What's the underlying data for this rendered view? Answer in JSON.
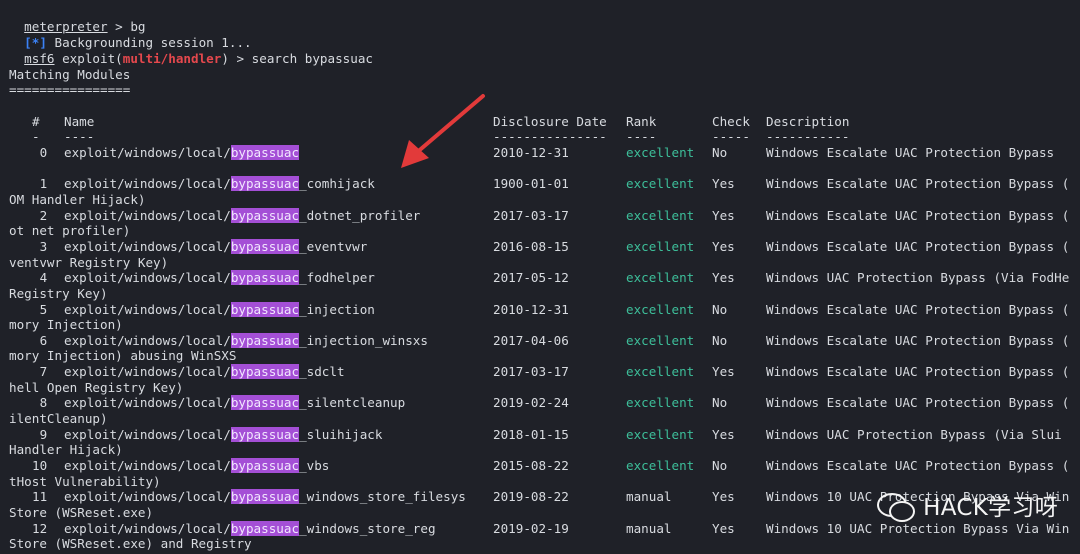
{
  "cmd_history": [
    {
      "type": "bg",
      "prompt": "meterpreter",
      "suffix": " > bg"
    },
    {
      "type": "info",
      "mark": "[*]",
      "text": " Backgrounding session 1..."
    },
    {
      "type": "search",
      "prompt": "msf6",
      "mid": " exploit(",
      "module": "multi/handler",
      "suffix": ") > search bypassuac"
    }
  ],
  "section_title": "Matching Modules",
  "section_underline": "================",
  "table": {
    "headers": {
      "num": "#",
      "name": "Name",
      "date": "Disclosure Date",
      "rank": "Rank",
      "check": "Check",
      "desc": "Description"
    },
    "header_underlines": {
      "num": "-",
      "name": "----",
      "date": "---------------",
      "rank": "----",
      "check": "-----",
      "desc": "-----------"
    },
    "rows": [
      {
        "num": "0",
        "prefix": "exploit/windows/local/",
        "hl": "bypassuac",
        "suffix": "",
        "date": "2010-12-31",
        "rank": "excellent",
        "check": "No",
        "desc": "Windows Escalate UAC Protection Bypass",
        "wrap": ""
      },
      {
        "num": "1",
        "prefix": "exploit/windows/local/",
        "hl": "bypassuac",
        "suffix": "_comhijack",
        "date": "1900-01-01",
        "rank": "excellent",
        "check": "Yes",
        "desc": "Windows Escalate UAC Protection Bypass (",
        "wrap": "OM Handler Hijack)"
      },
      {
        "num": "2",
        "prefix": "exploit/windows/local/",
        "hl": "bypassuac",
        "suffix": "_dotnet_profiler",
        "date": "2017-03-17",
        "rank": "excellent",
        "check": "Yes",
        "desc": "Windows Escalate UAC Protection Bypass (",
        "wrap": "ot net profiler)"
      },
      {
        "num": "3",
        "prefix": "exploit/windows/local/",
        "hl": "bypassuac",
        "suffix": "_eventvwr",
        "date": "2016-08-15",
        "rank": "excellent",
        "check": "Yes",
        "desc": "Windows Escalate UAC Protection Bypass (",
        "wrap": "ventvwr Registry Key)"
      },
      {
        "num": "4",
        "prefix": "exploit/windows/local/",
        "hl": "bypassuac",
        "suffix": "_fodhelper",
        "date": "2017-05-12",
        "rank": "excellent",
        "check": "Yes",
        "desc": "Windows UAC Protection Bypass (Via FodHe",
        "wrap": "Registry Key)"
      },
      {
        "num": "5",
        "prefix": "exploit/windows/local/",
        "hl": "bypassuac",
        "suffix": "_injection",
        "date": "2010-12-31",
        "rank": "excellent",
        "check": "No",
        "desc": "Windows Escalate UAC Protection Bypass (",
        "wrap": "mory Injection)"
      },
      {
        "num": "6",
        "prefix": "exploit/windows/local/",
        "hl": "bypassuac",
        "suffix": "_injection_winsxs",
        "date": "2017-04-06",
        "rank": "excellent",
        "check": "No",
        "desc": "Windows Escalate UAC Protection Bypass (",
        "wrap": "mory Injection) abusing WinSXS"
      },
      {
        "num": "7",
        "prefix": "exploit/windows/local/",
        "hl": "bypassuac",
        "suffix": "_sdclt",
        "date": "2017-03-17",
        "rank": "excellent",
        "check": "Yes",
        "desc": "Windows Escalate UAC Protection Bypass (",
        "wrap": "hell Open Registry Key)"
      },
      {
        "num": "8",
        "prefix": "exploit/windows/local/",
        "hl": "bypassuac",
        "suffix": "_silentcleanup",
        "date": "2019-02-24",
        "rank": "excellent",
        "check": "No",
        "desc": "Windows Escalate UAC Protection Bypass (",
        "wrap": "ilentCleanup)"
      },
      {
        "num": "9",
        "prefix": "exploit/windows/local/",
        "hl": "bypassuac",
        "suffix": "_sluihijack",
        "date": "2018-01-15",
        "rank": "excellent",
        "check": "Yes",
        "desc": "Windows UAC Protection Bypass (Via Slui",
        "wrap": "Handler Hijack)"
      },
      {
        "num": "10",
        "prefix": "exploit/windows/local/",
        "hl": "bypassuac",
        "suffix": "_vbs",
        "date": "2015-08-22",
        "rank": "excellent",
        "check": "No",
        "desc": "Windows Escalate UAC Protection Bypass (",
        "wrap": "tHost Vulnerability)"
      },
      {
        "num": "11",
        "prefix": "exploit/windows/local/",
        "hl": "bypassuac",
        "suffix": "_windows_store_filesys",
        "date": "2019-08-22",
        "rank": "manual",
        "check": "Yes",
        "desc": "Windows 10 UAC Protection Bypass Via Win",
        "wrap": "Store (WSReset.exe)"
      },
      {
        "num": "12",
        "prefix": "exploit/windows/local/",
        "hl": "bypassuac",
        "suffix": "_windows_store_reg",
        "date": "2019-02-19",
        "rank": "manual",
        "check": "Yes",
        "desc": "Windows 10 UAC Protection Bypass Via Win",
        "wrap": "Store (WSReset.exe) and Registry"
      }
    ]
  },
  "watermark": {
    "text": "HACK学习呀",
    "icon": "wechat-icon"
  },
  "annotation": {
    "icon": "red-arrow-icon",
    "color": "#e23a3a"
  },
  "colors": {
    "background": "#1f2128",
    "excellent": "#3dbf9a",
    "highlight": "#a44fd6",
    "prompt_red": "#e5484d",
    "info_blue": "#3b82f6"
  }
}
